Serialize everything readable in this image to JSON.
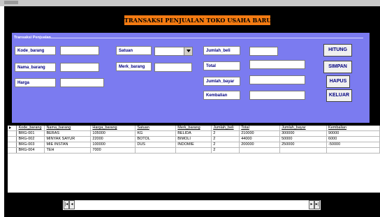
{
  "banner": {
    "title": "TRANSAKSI PENJUALAN TOKO USAHA BARU"
  },
  "form": {
    "group_label": "Transaksi Penjualan",
    "labels": {
      "kode_barang": "Kode_barang",
      "nama_barang": "Nama_barang",
      "harga": "Harga",
      "satuan": "Satuan",
      "merk_barang": "Merk_barang",
      "jumlah_beli": "Jumlah_beli",
      "total": "Total",
      "jumlah_bayar": "Jumlah_bayar",
      "kembalian": "Kembalian"
    },
    "values": {
      "kode_barang": "",
      "nama_barang": "",
      "harga": "",
      "satuan": "",
      "merk_barang": "",
      "jumlah_beli": "",
      "total": "",
      "jumlah_bayar": "",
      "kembalian": ""
    }
  },
  "buttons": {
    "hitung": "HITUNG",
    "simpan": "SIMPAN",
    "hapus": "HAPUS",
    "keluar": "KELUAR"
  },
  "grid": {
    "columns": [
      "Kode_barang",
      "Nama_barang",
      "Harga_barang",
      "Satuan",
      "Merk_barang",
      "Jumlah_beli",
      "Total",
      "Jumlah_bayar",
      "Kembalian"
    ],
    "rows": [
      [
        "BRG-001",
        "BERAS",
        "105000",
        "KG",
        "BELIDA",
        "2",
        "210000",
        "300000",
        "90000"
      ],
      [
        "BRG-002",
        "MINYAK SAYUR",
        "22000",
        "BOTOL",
        "BIMOLI",
        "2",
        "44000",
        "50000",
        "6000"
      ],
      [
        "BRG-003",
        "MIE INSTAN",
        "100000",
        "DUS",
        "INDOMIE",
        "2",
        "200000",
        "250000",
        "-50000"
      ],
      [
        "BRG-004",
        "TEH",
        "7000",
        "",
        "",
        "2",
        "",
        "",
        ""
      ]
    ]
  },
  "navigator": {
    "first_icon": "first-record-icon",
    "prev_icon": "previous-record-icon",
    "next_icon": "next-record-icon",
    "last_icon": "last-record-icon"
  }
}
